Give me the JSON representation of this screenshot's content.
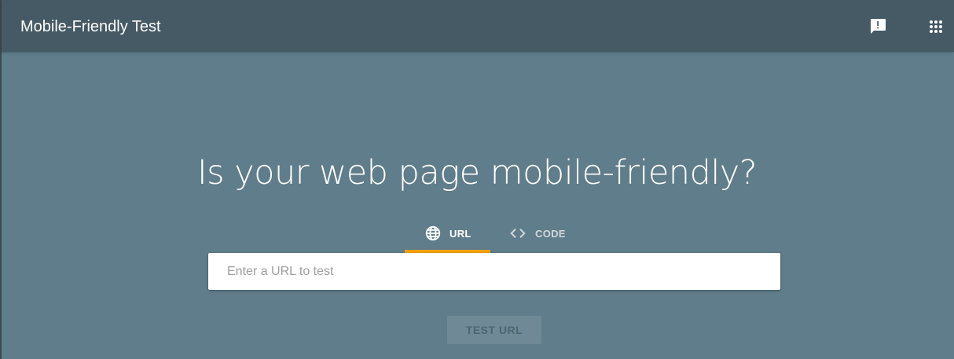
{
  "appbar": {
    "title": "Mobile-Friendly Test",
    "feedback_icon": "feedback-icon",
    "apps_icon": "apps-grid-icon"
  },
  "main": {
    "headline": "Is your web page mobile-friendly?",
    "tabs": [
      {
        "label": "URL",
        "icon": "globe-icon",
        "selected": true
      },
      {
        "label": "CODE",
        "icon": "code-icon",
        "selected": false
      }
    ],
    "url_input": {
      "value": "",
      "placeholder": "Enter a URL to test"
    },
    "test_button_label": "TEST URL"
  },
  "colors": {
    "appbar_bg": "#455a64",
    "page_bg": "#607d8b",
    "tab_indicator": "#f5a000",
    "button_bg": "#6f8a96"
  }
}
